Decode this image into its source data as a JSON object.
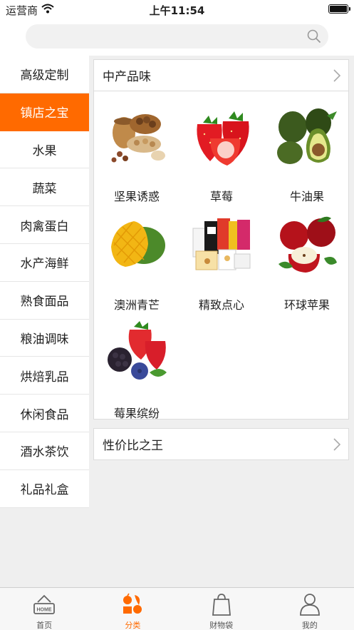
{
  "status_bar": {
    "carrier": "运营商",
    "time": "上午11:54"
  },
  "search": {
    "placeholder": ""
  },
  "sidebar": {
    "items": [
      {
        "label": "高级定制",
        "active": false
      },
      {
        "label": "镇店之宝",
        "active": true
      },
      {
        "label": "水果",
        "active": false
      },
      {
        "label": "蔬菜",
        "active": false
      },
      {
        "label": "肉禽蛋白",
        "active": false
      },
      {
        "label": "水产海鲜",
        "active": false
      },
      {
        "label": "熟食面品",
        "active": false
      },
      {
        "label": "粮油调味",
        "active": false
      },
      {
        "label": "烘焙乳品",
        "active": false
      },
      {
        "label": "休闲食品",
        "active": false
      },
      {
        "label": "酒水茶饮",
        "active": false
      },
      {
        "label": "礼品礼盒",
        "active": false
      }
    ]
  },
  "sections": [
    {
      "title": "中产品味",
      "products": [
        {
          "name": "坚果诱惑",
          "icon": "nuts-image"
        },
        {
          "name": "草莓",
          "icon": "strawberry-image"
        },
        {
          "name": "牛油果",
          "icon": "avocado-image"
        },
        {
          "name": "澳洲青芒",
          "icon": "mango-image"
        },
        {
          "name": "精致点心",
          "icon": "snacks-image"
        },
        {
          "name": "环球苹果",
          "icon": "apple-image"
        },
        {
          "name": "莓果缤纷",
          "icon": "berries-image"
        }
      ]
    },
    {
      "title": "性价比之王",
      "products": []
    }
  ],
  "tabbar": {
    "tabs": [
      {
        "label": "首页",
        "icon": "home-icon",
        "active": false
      },
      {
        "label": "分类",
        "icon": "category-icon",
        "active": true
      },
      {
        "label": "财物袋",
        "icon": "shopping-bag-icon",
        "active": false
      },
      {
        "label": "我的",
        "icon": "user-icon",
        "active": false
      }
    ]
  },
  "colors": {
    "accent": "#ff6a00",
    "background": "#efefef",
    "border": "#dcdcdc"
  }
}
